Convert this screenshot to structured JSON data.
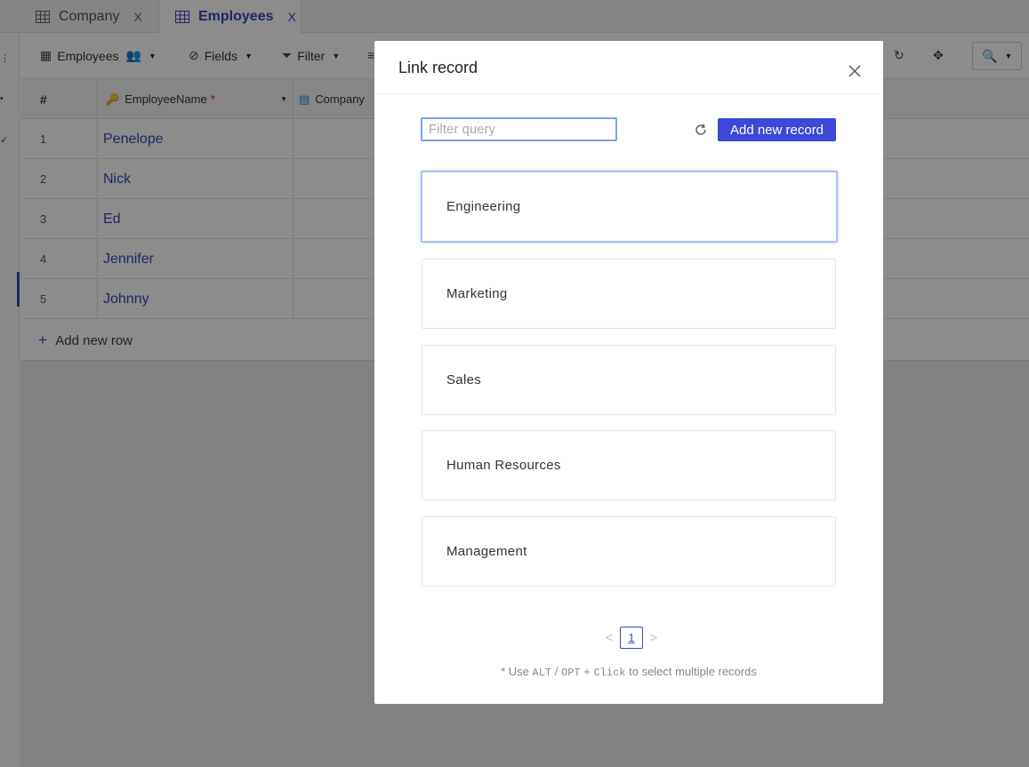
{
  "tabs": [
    {
      "label": "Company",
      "close": "X"
    },
    {
      "label": "Employees",
      "close": "X"
    }
  ],
  "toolbar": {
    "view_label": "Employees",
    "fields_label": "Fields",
    "filter_label": "Filter"
  },
  "grid": {
    "col_num": "#",
    "col_name": "EmployeeName",
    "col_name_required": "*",
    "col_company": "Company",
    "rows": [
      {
        "n": "1",
        "name": "Penelope"
      },
      {
        "n": "2",
        "name": "Nick"
      },
      {
        "n": "3",
        "name": "Ed"
      },
      {
        "n": "4",
        "name": "Jennifer"
      },
      {
        "n": "5",
        "name": "Johnny"
      }
    ],
    "add_row_label": "Add new row"
  },
  "modal": {
    "title": "Link record",
    "filter_placeholder": "Filter query",
    "filter_value": "",
    "add_button": "Add new record",
    "records": [
      "Engineering",
      "Marketing",
      "Sales",
      "Human Resources",
      "Management"
    ],
    "pagination": {
      "prev": "<",
      "current": "1",
      "next": ">"
    },
    "hint_prefix": "* Use",
    "hint_key1": "ALT",
    "hint_sep": "/",
    "hint_key2": "OPT",
    "hint_plus": "+",
    "hint_key3": "Click",
    "hint_suffix": "to select multiple records"
  },
  "colors": {
    "accent": "#3d48d8",
    "link": "#3b4ab8",
    "focus": "#7aa3e8"
  }
}
